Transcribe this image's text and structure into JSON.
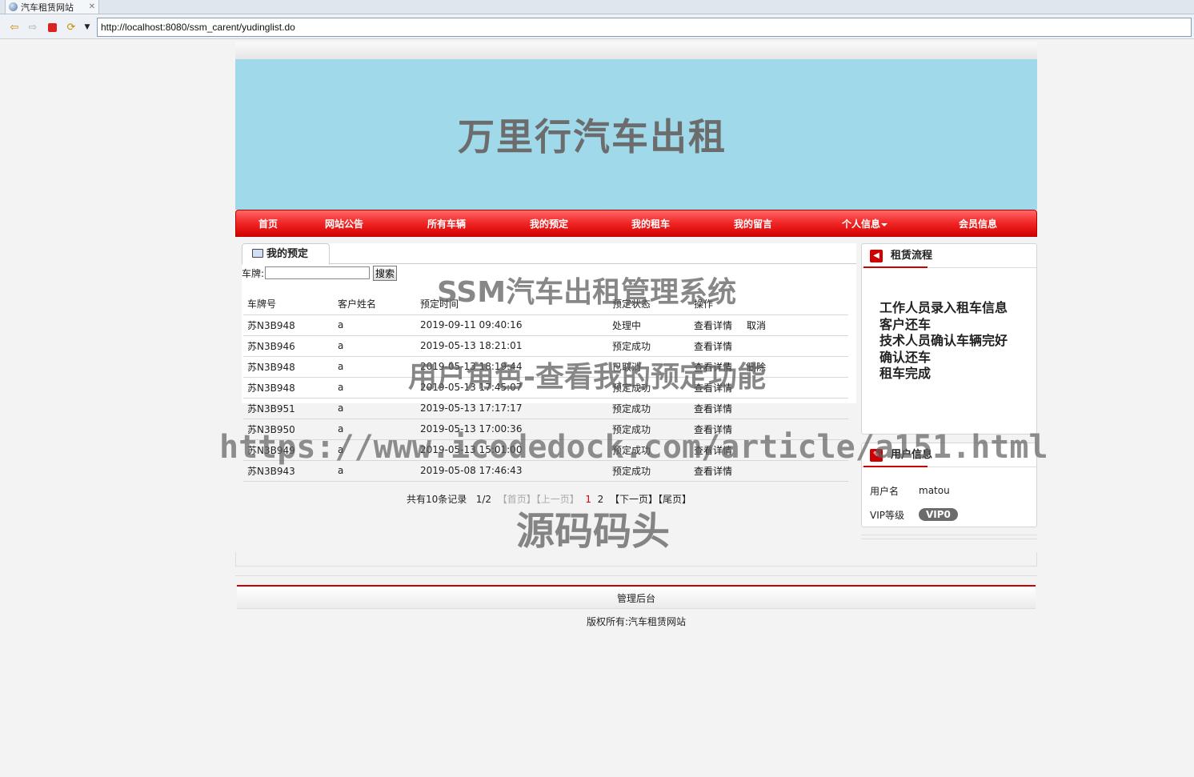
{
  "browser": {
    "tab_title": "汽车租赁网站",
    "url": "http://localhost:8080/ssm_carent/yudinglist.do"
  },
  "banner": {
    "title": "万里行汽车出租"
  },
  "nav": {
    "items": [
      "首页",
      "网站公告",
      "所有车辆",
      "我的预定",
      "我的租车",
      "我的留言",
      "个人信息",
      "会员信息"
    ]
  },
  "section": {
    "title": "我的预定",
    "search_label": "车牌:",
    "search_value": "",
    "search_button": "搜索"
  },
  "table": {
    "headers": [
      "车牌号",
      "客户姓名",
      "预定时间",
      "预定状态",
      "操作"
    ],
    "rows": [
      {
        "plate": "苏N3B948",
        "name": "a",
        "time": "2019-09-11 09:40:16",
        "status": "处理中",
        "op1": "查看详情",
        "op2": "取消"
      },
      {
        "plate": "苏N3B946",
        "name": "a",
        "time": "2019-05-13 18:21:01",
        "status": "预定成功",
        "op1": "查看详情",
        "op2": ""
      },
      {
        "plate": "苏N3B948",
        "name": "a",
        "time": "2019-05-13 18:19:44",
        "status": "已取消",
        "op1": "查看详情",
        "op2": "删除"
      },
      {
        "plate": "苏N3B948",
        "name": "a",
        "time": "2019-05-13 17:45:07",
        "status": "预定成功",
        "op1": "查看详情",
        "op2": ""
      },
      {
        "plate": "苏N3B951",
        "name": "a",
        "time": "2019-05-13 17:17:17",
        "status": "预定成功",
        "op1": "查看详情",
        "op2": ""
      },
      {
        "plate": "苏N3B950",
        "name": "a",
        "time": "2019-05-13 17:00:36",
        "status": "预定成功",
        "op1": "查看详情",
        "op2": ""
      },
      {
        "plate": "苏N3B949",
        "name": "a",
        "time": "2019-05-13 15:01:00",
        "status": "预定成功",
        "op1": "查看详情",
        "op2": ""
      },
      {
        "plate": "苏N3B943",
        "name": "a",
        "time": "2019-05-08 17:46:43",
        "status": "预定成功",
        "op1": "查看详情",
        "op2": ""
      }
    ]
  },
  "pager": {
    "total": "共有10条记录",
    "page": "1/2",
    "first": "【首页】",
    "prev": "【上一页】",
    "p1": "1",
    "p2": "2",
    "next": "【下一页】",
    "last": "【尾页】"
  },
  "sidebar": {
    "flow_title": "租赁流程",
    "flow_steps": [
      "工作人员录入租车信息",
      "客户还车",
      "技术人员确认车辆完好",
      "确认还车",
      "租车完成"
    ],
    "user_title": "用户信息",
    "username_label": "用户名",
    "username": "matou",
    "vip_label": "VIP等级",
    "vip": "VIP0"
  },
  "footer": {
    "admin": "管理后台",
    "copyright": "版权所有:汽车租赁网站"
  },
  "watermarks": {
    "w1": "SSM汽车出租管理系统",
    "w2": "用户角色-查看我的预定功能",
    "w3": "https://www.icodedock.com/article/a151.html",
    "w4": "源码码头"
  },
  "colors": {
    "banner_bg": "#9fd9ea",
    "nav_red": "#e81c1c",
    "accent": "#cc0000"
  }
}
